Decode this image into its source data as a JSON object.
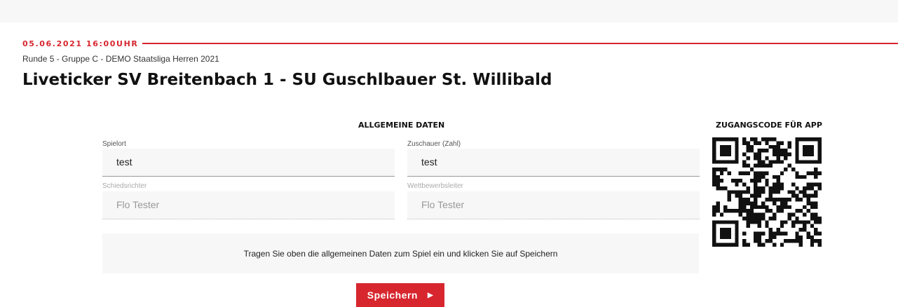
{
  "header": {
    "datetime": "05.06.2021 16:00UHR",
    "subtitle": "Runde 5 - Gruppe C - DEMO Staatsliga Herren 2021",
    "title": "Liveticker SV Breitenbach 1 - SU Guschlbauer St. Willibald"
  },
  "form": {
    "heading": "ALLGEMEINE DATEN",
    "fields": [
      {
        "label": "Spielort",
        "value": "test"
      },
      {
        "label": "Zuschauer (Zahl)",
        "value": "test"
      },
      {
        "label": "Schiedsrichter",
        "value": "Flo Tester"
      },
      {
        "label": "Wettbewerbsleiter",
        "value": "Flo Tester"
      }
    ],
    "info": "Tragen Sie oben die allgemeinen Daten zum Spiel ein und klicken Sie auf Speichern",
    "save_label": "Speichern"
  },
  "app_code": {
    "heading": "ZUGANGSCODE FÜR APP"
  },
  "colors": {
    "accent": "#d7262e",
    "field_bg": "#f7f7f7"
  }
}
